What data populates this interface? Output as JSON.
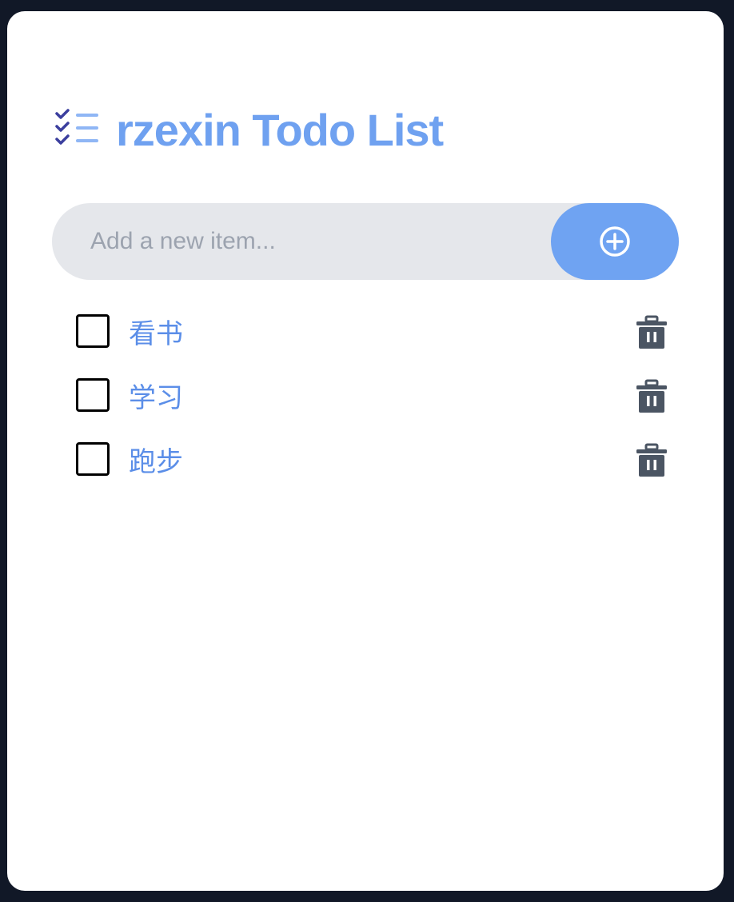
{
  "app": {
    "title": "rzexin Todo List",
    "logo_icon": "checklist-icon"
  },
  "add_form": {
    "placeholder": "Add a new item...",
    "value": "",
    "button_icon": "plus-circle-icon",
    "button_color": "#6fa3f2",
    "input_bg": "#e5e7eb"
  },
  "todos": [
    {
      "text": "看书",
      "checked": false
    },
    {
      "text": "学习",
      "checked": false
    },
    {
      "text": "跑步",
      "checked": false
    }
  ],
  "colors": {
    "background": "#111827",
    "card": "#ffffff",
    "accent": "#6fa1f0",
    "item_text": "#5b8ee8",
    "trash": "#4b5563"
  }
}
